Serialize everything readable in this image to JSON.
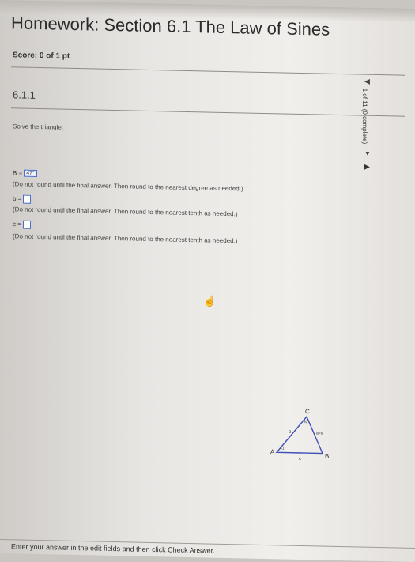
{
  "header": {
    "title": "Homework: Section 6.1 The Law of Sines",
    "score": "Score: 0 of 1 pt"
  },
  "question": {
    "number": "6.1.1",
    "navigation": {
      "progress": "1 of 11 (0 complete)",
      "prev_icon": "triangle-left-icon",
      "next_icon": "triangle-right-icon",
      "dropdown_icon": "triangle-down-icon"
    },
    "instructions": "Solve the triangle.",
    "answers": {
      "B_label": "B =",
      "B_value": "47°",
      "B_note": "(Do not round until the final answer. Then round to the nearest degree as needed.)",
      "b_label": "b ≈",
      "b_note": "(Do not round until the final answer. Then round to the nearest tenth as needed.)",
      "c_label": "c ≈",
      "c_note": "(Do not round until the final answer. Then round to the nearest tenth as needed.)"
    },
    "figure": {
      "vertex_A": "A",
      "vertex_B": "B",
      "vertex_C": "C",
      "side_a": "a=9",
      "side_b": "b",
      "side_c": "c",
      "angle_A": "41°",
      "angle_C": "92°"
    }
  },
  "footer": {
    "instruction": "Enter your answer in the edit fields and then click Check Answer."
  },
  "colors": {
    "accent": "#4a6ec9",
    "triangle": "#3b4fb8"
  }
}
